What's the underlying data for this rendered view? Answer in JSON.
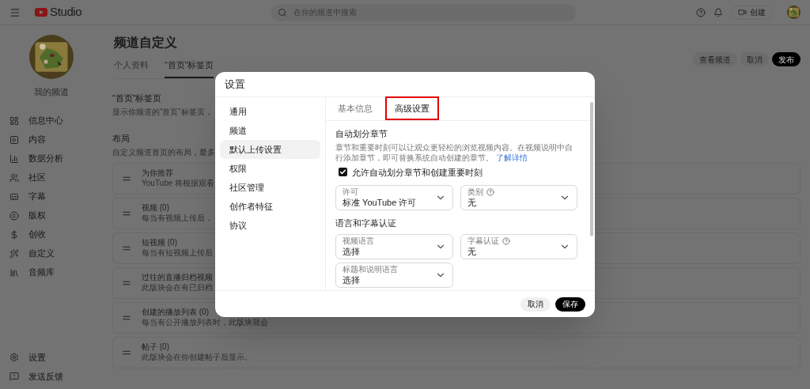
{
  "header": {
    "logo_text": "Studio",
    "search": {
      "placeholder": "在你的频道中搜索"
    },
    "create_button": "创建"
  },
  "sidebar": {
    "channel_name": "我的频道",
    "items": [
      {
        "label": "信息中心"
      },
      {
        "label": "内容"
      },
      {
        "label": "数据分析"
      },
      {
        "label": "社区"
      },
      {
        "label": "字幕"
      },
      {
        "label": "版权"
      },
      {
        "label": "创收"
      },
      {
        "label": "自定义"
      },
      {
        "label": "音频库"
      }
    ],
    "bottom_items": [
      {
        "label": "设置"
      },
      {
        "label": "发送反馈"
      }
    ]
  },
  "page": {
    "title": "频道自定义",
    "tabs": [
      {
        "label": "个人资料",
        "selected": false
      },
      {
        "label": "“首页”标签页",
        "selected": true
      }
    ],
    "actions": [
      {
        "label": "查看频道",
        "primary": false
      },
      {
        "label": "取消",
        "primary": false
      },
      {
        "label": "发布",
        "primary": true
      }
    ],
    "home_section": {
      "title": "“首页”标签页",
      "description": "显示你频道的“首页”标签页，"
    },
    "layout_section": {
      "title": "布局",
      "description": "自定义频道首页的布局，最多"
    },
    "cards": [
      {
        "title": "为你推荐",
        "description": "YouTube 将根据观看"
      },
      {
        "title": "视频 (0)",
        "description": "每当有视频上传后，"
      },
      {
        "title": "短视频 (0)",
        "description": "每当有短视频上传后"
      },
      {
        "title": "过往的直播归档视频",
        "description": "此版块会在有已归档"
      },
      {
        "title": "创建的播放列表 (0)",
        "description": "每当有公开播放列表时，此版块就会"
      },
      {
        "title": "帖子 (0)",
        "description": "此版块会在你创建帖子后显示。"
      }
    ]
  },
  "dialog": {
    "title": "设置",
    "nav": [
      {
        "label": "通用",
        "selected": false
      },
      {
        "label": "频道",
        "selected": false
      },
      {
        "label": "默认上传设置",
        "selected": true
      },
      {
        "label": "权限",
        "selected": false
      },
      {
        "label": "社区管理",
        "selected": false
      },
      {
        "label": "创作者特征",
        "selected": false
      },
      {
        "label": "协议",
        "selected": false
      }
    ],
    "tabs": [
      {
        "label": "基本信息",
        "selected": false,
        "highlighted": false
      },
      {
        "label": "高级设置",
        "selected": true,
        "highlighted": true
      }
    ],
    "chapters": {
      "title": "自动划分章节",
      "description": "章节和重要时刻可以让观众更轻松的浏览视频内容。在视频说明中自行添加章节，即可替换系统自动创建的章节。",
      "link": "了解详情",
      "checkbox": {
        "label": "允许自动划分章节和创建重要时刻",
        "checked": true
      }
    },
    "fields": [
      {
        "label": "许可",
        "value": "标准 YouTube 许可",
        "help": false
      },
      {
        "label": "类别",
        "value": "无",
        "help": true
      }
    ],
    "language": {
      "title": "语言和字幕认证",
      "fields": [
        {
          "label": "视频语言",
          "value": "选择",
          "help": false
        },
        {
          "label": "字幕认证",
          "value": "无",
          "help": true
        },
        {
          "label": "标题和说明语言",
          "value": "选择",
          "help": false
        }
      ]
    },
    "buttons": [
      {
        "label": "取消",
        "primary": false
      },
      {
        "label": "保存",
        "primary": true
      }
    ]
  }
}
